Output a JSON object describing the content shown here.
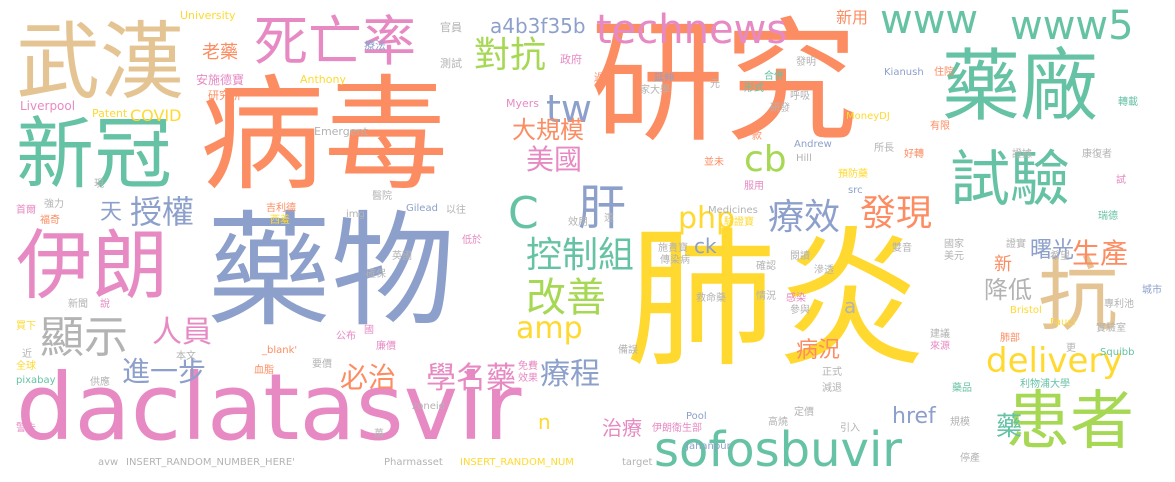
{
  "colors": {
    "background": "#ffffff",
    "orange": "#fc8d62",
    "blue": "#8da0cb",
    "pink": "#e78ac3",
    "green": "#a6d854",
    "yellow": "#ffd92f",
    "tan": "#e5c494",
    "teal": "#66c2a5",
    "gray": "#b3b3b3"
  },
  "words": {
    "w_bingdu": "病毒",
    "w_yanjiu": "研究",
    "w_yaowu": "藥物",
    "w_feiyan": "肺炎",
    "w_daclatasvir": "daclatasvir",
    "w_wuhan": "武漢",
    "w_yaochang": "藥廠",
    "w_xinguan": "新冠",
    "w_yilang": "伊朗",
    "w_siwanglu": "死亡率",
    "w_shiyan": "試驗",
    "w_huanzhe": "患者",
    "w_kang": "抗",
    "w_sofosbuvir": "sofosbuvir",
    "w_technews": "technews",
    "w_www": "www",
    "w_www5": "www5",
    "w_duikang": "對抗",
    "w_c": "C",
    "w_gan": "肝",
    "w_php": "php",
    "w_liaoxiao": "療效",
    "w_faxian": "發現",
    "w_xianshi": "顯示",
    "w_gaishan": "改善",
    "w_kongzhizu": "控制組",
    "w_delivery": "delivery",
    "w_amp": "amp",
    "w_tw": "tw",
    "w_cb": "cb",
    "w_a4b3f35b": "a4b3f35b",
    "w_daguimo": "大規模",
    "w_meiguo": "美國",
    "w_renyuan": "人員",
    "w_jinyibu": "進一步",
    "w_bizhi": "必治",
    "w_xuemingyao": "學名藥",
    "w_liaocheng": "療程",
    "w_shengchan": "生產",
    "w_shuguang": "曙光",
    "w_jiangdi": "降低",
    "w_tian": "天",
    "w_shouquan": "授權",
    "w_laoyao": "老藥",
    "w_xinyong": "新用",
    "w_xin": "新",
    "w_bingkuang": "病況",
    "w_href": "href",
    "w_yao": "藥",
    "w_zhiliao": "治療",
    "w_n": "n",
    "w_a": "a",
    "w_ck": "ck",
    "w_covid": "COVID",
    "w_university": "University",
    "w_liverpool": "Liverpool",
    "w_patent": "Patent",
    "w_yanjiusuo": "研究所",
    "w_anshidezhao": "安施德寶",
    "w_liaofa": "療法",
    "w_anthony": "Anthony",
    "w_guanyuan": "官員",
    "w_ceshi": "測試",
    "w_zhengfu": "政府",
    "w_myers": "Myers",
    "w_emergent": "Emergent",
    "w_guojian": "過敏",
    "w_yanshen": "延伸",
    "w_jiadaxue": "家大學",
    "w_yuan": "元",
    "w_faming": "發明",
    "w_hejian": "合併",
    "w_xingshi": "形式",
    "w_kianush": "Kianush",
    "w_zhuyuan": "住院",
    "w_zhuanxu": "轉載",
    "w_moneydj": "MoneyDJ",
    "w_huxi": "呼吸",
    "w_yanfa": "研發",
    "w_kuan": "款",
    "w_andrew": "Andrew",
    "w_youxian": "有限",
    "w_suozhang": "所長",
    "w_hill": "Hill",
    "w_yufangyao": "預防藥",
    "w_haozhuan": "好轉",
    "w_zhengju": "證據",
    "w_kanghouzhe": "康復者",
    "w_ruide": "瑞德",
    "w_bingwei": "並未",
    "w_fuyong": "服用",
    "w_src": "src",
    "w_shi": "試",
    "w_shouye": "首爾",
    "w_xian": "現",
    "w_qiangli": "強力",
    "w_fuqi": "福奇",
    "w_jitiande": "吉利德",
    "w_xichu": "西羞",
    "w_yiyuan": "醫院",
    "w_img": "img",
    "w_gilead": "Gilead",
    "w_yiwang": "以往",
    "w_medicines": "Medicines",
    "w_xiaoyong": "效用",
    "w_yuan2": "遠",
    "w_yanzhengbao": "驗證寶",
    "w_dimao": "低於",
    "w_shiyanbao": "施貴寶",
    "w_chuanranbing": "傳染病",
    "w_queren": "確認",
    "w_yuedu": "閱讀",
    "w_shuangyin": "雙音",
    "w_guojia": "國家",
    "w_zhengshi": "證實",
    "w_meiyuan": "美元",
    "w_xiwang": "希望",
    "w_shenliao": "滲透",
    "w_yingguo": "英國",
    "w_quebao": "確保",
    "w_jiumingyao": "救命藥",
    "w_qingkuang": "情況",
    "w_ganran": "感染",
    "w_canyu": "參與",
    "w_chengshi": "城市",
    "w_zhuanlichi": "專利池",
    "w_bristol": "Bristol",
    "w_fauci": "Fauci",
    "w_xinwen": "新聞",
    "w_shuo": "說",
    "w_maixia": "買下",
    "w_gongbu": "公布",
    "w_guo": "國",
    "w_jianyi": "建議",
    "w_laiyuan": "來源",
    "w_feibu": "肺部",
    "w_shiyanshi": "實驗室",
    "w_quanqiu": "全球",
    "w_benwen": "本文",
    "w_xuezhi": "血脂",
    "w_blank": "_blank'",
    "w_lianjia": "廉價",
    "w_mianfei": "免費",
    "w_xiaoguo": "效果",
    "w_tianhui": "備誤",
    "w_zhengshi2": "正式",
    "w_geng": "更",
    "w_squibb": "Squibb",
    "w_jin": "近",
    "w_pixabay": "pixabay",
    "w_gongying": "供應",
    "w_yaoqiu": "要價",
    "w_yaopin": "藥品",
    "w_jiantui": "減退",
    "w_liwupu": "利物浦大學",
    "w_zoneid": "zoneid",
    "w_pool": "Pool",
    "w_jinggao": "警告",
    "w_wan": "萬",
    "w_yilangweisheng": "伊朗衛生部",
    "w_gaowei": "高燒",
    "w_dingjia": "定價",
    "w_yinru": "引入",
    "w_guimo": "規模",
    "w_jahanpur": "Jahanpur",
    "w_tingchan": "停產",
    "w_avw": "avw",
    "w_insert1": "INSERT_RANDOM_NUMBER_HERE'",
    "w_pharmasset": "Pharmasset",
    "w_insert2": "INSERT_RANDOM_NUM",
    "w_target": "target"
  }
}
